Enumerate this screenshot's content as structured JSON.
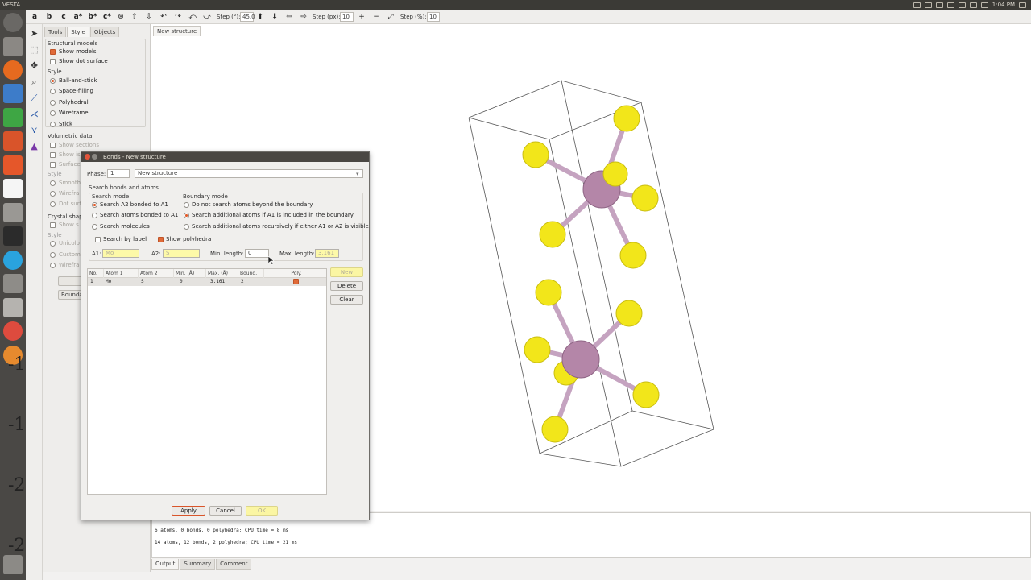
{
  "topbar": {
    "app_title": "VESTA",
    "clock": "1:04 PM"
  },
  "toolbar": {
    "letters": [
      "a",
      "b",
      "c",
      "a*",
      "b*",
      "c*"
    ],
    "step_deg_label": "Step (°):",
    "step_deg_value": "45.0",
    "step_px_label": "Step (px):",
    "step_px_value": "10",
    "step_pct_label": "Step (%):",
    "step_pct_value": "10"
  },
  "sidepanel": {
    "tabs": [
      "Tools",
      "Style",
      "Objects"
    ],
    "structural_models": {
      "header": "Structural models",
      "show_models": "Show models",
      "show_dot_surface": "Show dot surface"
    },
    "style": {
      "header": "Style",
      "options": [
        "Ball-and-stick",
        "Space-filling",
        "Polyhedral",
        "Wireframe",
        "Stick"
      ]
    },
    "volumetric": {
      "header": "Volumetric data",
      "show_sections": "Show sections",
      "show_is": "Show is",
      "surface": "Surface",
      "style_header": "Style",
      "smooth": "Smooth",
      "wireframe": "Wirefra",
      "dot_surface": "Dot surf"
    },
    "crystal_shape": {
      "header": "Crystal shap",
      "show_s": "Show s",
      "style_header": "Style",
      "unicolor": "Unicolo",
      "custom": "Custom",
      "wireframe": "Wirefra"
    },
    "boundary_button": "Bounda"
  },
  "viewport": {
    "tab": "New structure"
  },
  "console": {
    "lines": [
      "6 atoms, 0 bonds, 0 polyhedra; CPU time = 8 ms",
      "14 atoms, 12 bonds, 2 polyhedra; CPU time = 21 ms"
    ],
    "tabs": [
      "Output",
      "Summary",
      "Comment"
    ]
  },
  "background_axis_text": [
    "-1",
    "-1",
    "-2",
    "-2"
  ],
  "dialog": {
    "title": "Bonds - New structure",
    "phase_label": "Phase:",
    "phase_value": "1",
    "phase_name": "New structure",
    "search_group": "Search bonds and atoms",
    "search_mode": {
      "header": "Search mode",
      "options": [
        "Search A2 bonded to A1",
        "Search atoms bonded to A1",
        "Search molecules"
      ]
    },
    "boundary_mode": {
      "header": "Boundary mode",
      "options": [
        "Do not search atoms beyond the boundary",
        "Search additional atoms if A1 is included in the boundary",
        "Search additional atoms recursively if either A1 or A2 is visible"
      ]
    },
    "search_by_label": "Search by label",
    "show_polyhedra": "Show polyhedra",
    "a1_label": "A1:",
    "a1_value": "Mo",
    "a2_label": "A2:",
    "a2_value": "S",
    "min_length_label": "Min. length:",
    "min_length_value": "0",
    "max_length_label": "Max. length:",
    "max_length_value": "3.161",
    "table": {
      "headers": [
        "No.",
        "Atom 1",
        "Atom 2",
        "Min. (Å)",
        "Max. (Å)",
        "Bound.",
        "Poly."
      ],
      "rows": [
        {
          "no": "1",
          "atom1": "Mo",
          "atom2": "S",
          "min": "0",
          "max": "3.161",
          "bound": "2",
          "poly": true
        }
      ]
    },
    "buttons": {
      "new": "New",
      "delete": "Delete",
      "clear": "Clear",
      "apply": "Apply",
      "cancel": "Cancel",
      "ok": "OK"
    }
  },
  "colors": {
    "accent": "#e25b2a",
    "highlight": "#fdf9a8",
    "sulfur": "#f2e61a",
    "molybdenum": "#b486a8"
  }
}
